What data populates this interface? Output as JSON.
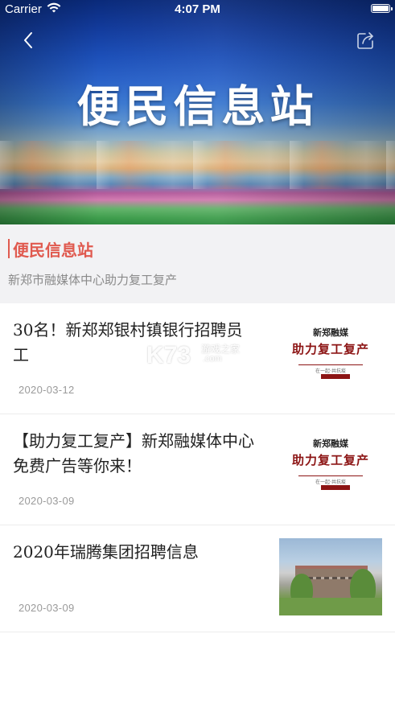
{
  "status_bar": {
    "carrier": "Carrier",
    "time": "4:07 PM",
    "wifi_icon": "wifi-icon",
    "battery_icon": "battery-icon"
  },
  "nav": {
    "back_icon": "chevron-left-icon",
    "share_icon": "share-icon"
  },
  "banner": {
    "title": "便民信息站"
  },
  "channel": {
    "name": "便民信息站",
    "description": "新郑市融媒体中心助力复工复产",
    "accent_color": "#e05a4f"
  },
  "news": [
    {
      "title": "30名！新郑郑银村镇银行招聘员工",
      "date": "2020-03-12",
      "thumbnail": {
        "type": "promo",
        "org": "新郑融媒",
        "slogan": "助力复工复产",
        "sub": "在一起·共抗疫"
      }
    },
    {
      "title": "【助力复工复产】新郑融媒体中心免费广告等你来！",
      "date": "2020-03-09",
      "thumbnail": {
        "type": "promo",
        "org": "新郑融媒",
        "slogan": "助力复工复产",
        "sub": "在一起·共抗疫"
      }
    },
    {
      "title": "2020年瑞腾集团招聘信息",
      "date": "2020-03-09",
      "thumbnail": {
        "type": "photo"
      }
    }
  ],
  "watermark": {
    "logo": "K73",
    "text": "游戏之家",
    "domain": ".com"
  }
}
